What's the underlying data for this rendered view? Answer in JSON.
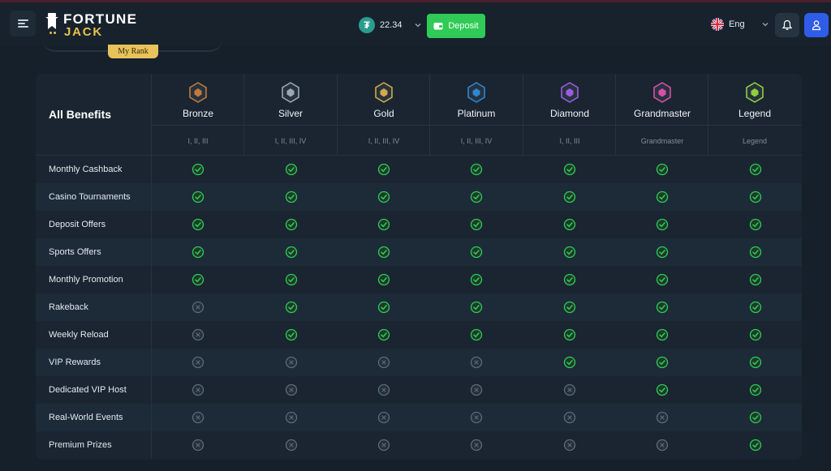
{
  "header": {
    "logo_line1": "FORTUNE",
    "logo_line2": "JACK",
    "balance_currency_icon": "tether-coin-icon",
    "balance_value": "22.34",
    "deposit_label": "Deposit",
    "language_label": "Eng",
    "language_flag": "uk-flag-icon"
  },
  "rank": {
    "tag_label": "My Rank"
  },
  "table": {
    "heading": "All Benefits",
    "tiers": [
      {
        "name": "Bronze",
        "levels": "I, II, III",
        "color": "#c07a3a"
      },
      {
        "name": "Silver",
        "levels": "I, II, III, IV",
        "color": "#9aa7b5"
      },
      {
        "name": "Gold",
        "levels": "I, II, III, IV",
        "color": "#d3a94a"
      },
      {
        "name": "Platinum",
        "levels": "I, II, III, IV",
        "color": "#2f86d1"
      },
      {
        "name": "Diamond",
        "levels": "I, II, III",
        "color": "#9b5de0"
      },
      {
        "name": "Grandmaster",
        "levels": "Grandmaster",
        "color": "#d94fa8"
      },
      {
        "name": "Legend",
        "levels": "Legend",
        "color": "#8fcf3a"
      }
    ],
    "benefits": [
      {
        "label": "Monthly Cashback",
        "available": [
          true,
          true,
          true,
          true,
          true,
          true,
          true
        ]
      },
      {
        "label": "Casino Tournaments",
        "available": [
          true,
          true,
          true,
          true,
          true,
          true,
          true
        ]
      },
      {
        "label": "Deposit Offers",
        "available": [
          true,
          true,
          true,
          true,
          true,
          true,
          true
        ]
      },
      {
        "label": "Sports Offers",
        "available": [
          true,
          true,
          true,
          true,
          true,
          true,
          true
        ]
      },
      {
        "label": "Monthly Promotion",
        "available": [
          true,
          true,
          true,
          true,
          true,
          true,
          true
        ]
      },
      {
        "label": "Rakeback",
        "available": [
          false,
          true,
          true,
          true,
          true,
          true,
          true
        ]
      },
      {
        "label": "Weekly Reload",
        "available": [
          false,
          true,
          true,
          true,
          true,
          true,
          true
        ]
      },
      {
        "label": "VIP Rewards",
        "available": [
          false,
          false,
          false,
          false,
          true,
          true,
          true
        ]
      },
      {
        "label": "Dedicated VIP Host",
        "available": [
          false,
          false,
          false,
          false,
          false,
          true,
          true
        ]
      },
      {
        "label": "Real-World Events",
        "available": [
          false,
          false,
          false,
          false,
          false,
          false,
          true
        ]
      },
      {
        "label": "Premium Prizes",
        "available": [
          false,
          false,
          false,
          false,
          false,
          false,
          true
        ]
      }
    ],
    "check_color": "#2fcb56",
    "cross_color": "#5c6b79"
  }
}
